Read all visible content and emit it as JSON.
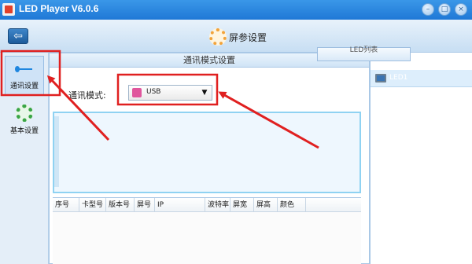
{
  "window": {
    "title": "LED Player V6.0.6",
    "minimize_glyph": "–",
    "maximize_glyph": "□",
    "close_glyph": "×"
  },
  "header": {
    "back_glyph": "⇦",
    "title": "屏参设置"
  },
  "sidebar": {
    "items": [
      {
        "label": "通讯设置",
        "icon": "usb-icon",
        "active": true
      },
      {
        "label": "基本设置",
        "icon": "gear-icon",
        "active": false
      }
    ]
  },
  "main": {
    "panel_title": "通讯模式设置",
    "comm_mode_label": "通讯模式:",
    "comm_mode_value": "USB",
    "dropdown_arrow": "▼",
    "table": {
      "columns": [
        "序号",
        "卡型号",
        "版本号",
        "屏号",
        "IP",
        "波特率",
        "屏宽",
        "屏高",
        "颜色"
      ]
    }
  },
  "right_panel": {
    "tab_label": "LED列表",
    "items": [
      {
        "label": "LED1"
      }
    ]
  },
  "colors": {
    "titlebar": "#1f78d6",
    "annotation_red": "#e02020",
    "selected_item": "#ddeefc"
  }
}
